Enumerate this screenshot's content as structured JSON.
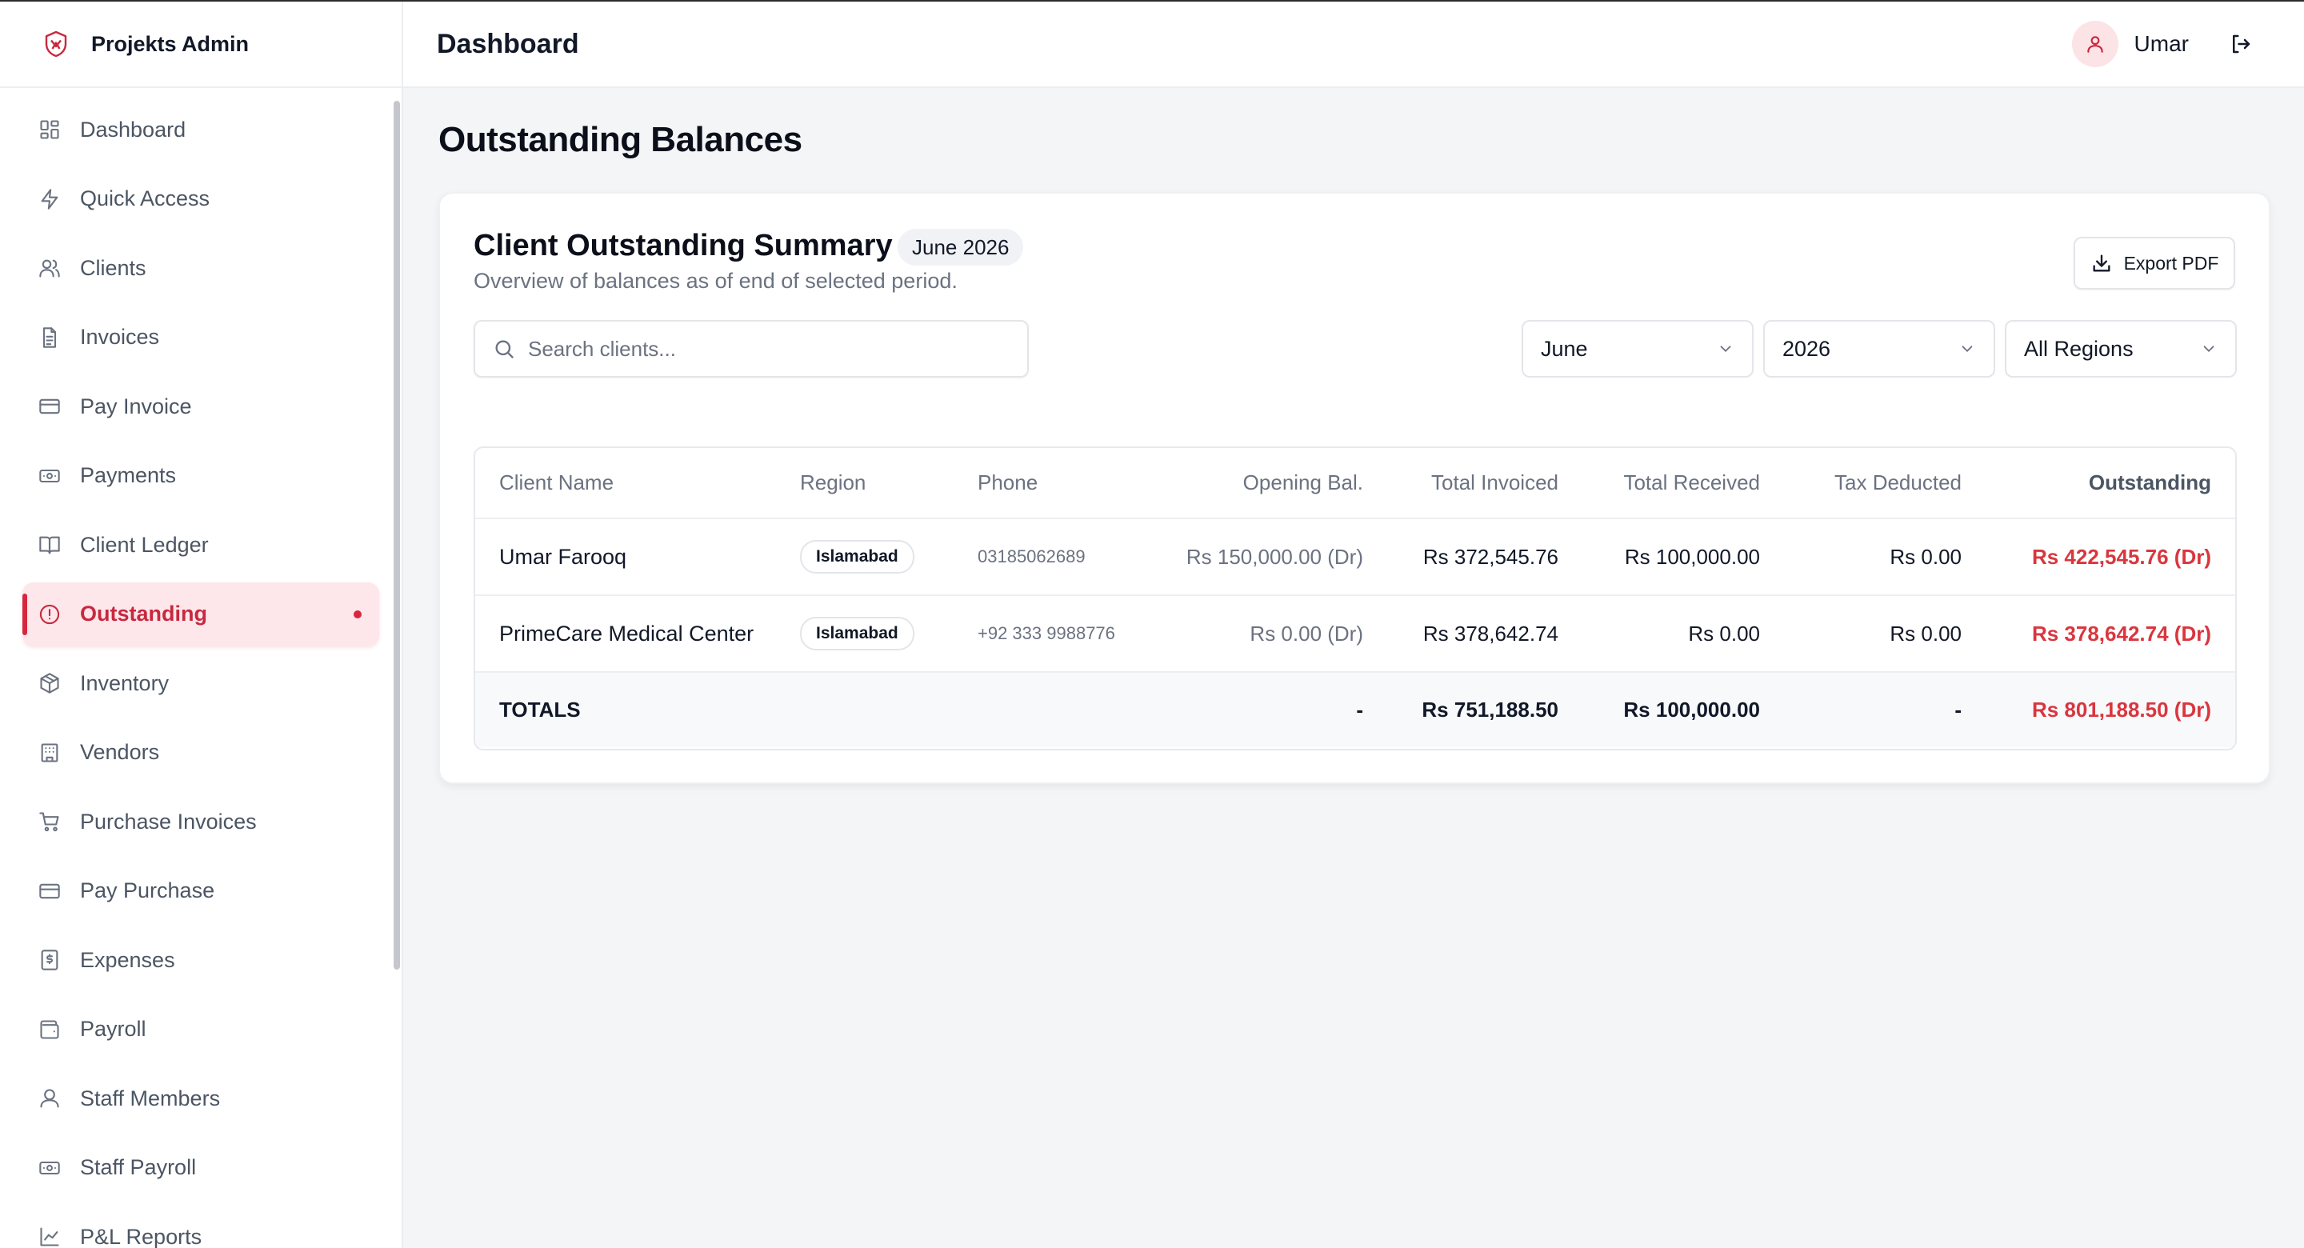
{
  "brand": {
    "name": "Projekts Admin"
  },
  "sidebar": {
    "items": [
      {
        "label": "Dashboard",
        "icon": "dashboard-icon"
      },
      {
        "label": "Quick Access",
        "icon": "lightning-icon"
      },
      {
        "label": "Clients",
        "icon": "users-icon"
      },
      {
        "label": "Invoices",
        "icon": "document-icon"
      },
      {
        "label": "Pay Invoice",
        "icon": "credit-card-icon"
      },
      {
        "label": "Payments",
        "icon": "cash-icon"
      },
      {
        "label": "Client Ledger",
        "icon": "book-icon"
      },
      {
        "label": "Outstanding",
        "icon": "alert-circle-icon",
        "active": true
      },
      {
        "label": "Inventory",
        "icon": "package-icon"
      },
      {
        "label": "Vendors",
        "icon": "building-icon"
      },
      {
        "label": "Purchase Invoices",
        "icon": "cart-icon"
      },
      {
        "label": "Pay Purchase",
        "icon": "credit-card-icon"
      },
      {
        "label": "Expenses",
        "icon": "receipt-icon"
      },
      {
        "label": "Payroll",
        "icon": "wallet-icon"
      },
      {
        "label": "Staff Members",
        "icon": "user-icon"
      },
      {
        "label": "Staff Payroll",
        "icon": "cash-icon"
      },
      {
        "label": "P&L Reports",
        "icon": "chart-icon"
      }
    ]
  },
  "header": {
    "title": "Dashboard",
    "user_name": "Umar"
  },
  "page": {
    "title": "Outstanding Balances"
  },
  "card": {
    "title": "Client Outstanding Summary",
    "period_badge": "June 2026",
    "subtitle": "Overview of balances as of end of selected period.",
    "export_label": "Export PDF",
    "search_placeholder": "Search clients...",
    "filters": {
      "month": "June",
      "year": "2026",
      "region": "All Regions"
    }
  },
  "table": {
    "columns": [
      "Client Name",
      "Region",
      "Phone",
      "Opening Bal.",
      "Total Invoiced",
      "Total Received",
      "Tax Deducted",
      "Outstanding"
    ],
    "rows": [
      {
        "name": "Umar Farooq",
        "region": "Islamabad",
        "phone": "03185062689",
        "opening": "Rs 150,000.00 (Dr)",
        "invoiced": "Rs 372,545.76",
        "received": "Rs 100,000.00",
        "tax": "Rs 0.00",
        "outstanding": "Rs 422,545.76 (Dr)"
      },
      {
        "name": "PrimeCare Medical Center",
        "region": "Islamabad",
        "phone": "+92 333 9988776",
        "opening": "Rs 0.00 (Dr)",
        "invoiced": "Rs 378,642.74",
        "received": "Rs 0.00",
        "tax": "Rs 0.00",
        "outstanding": "Rs 378,642.74 (Dr)"
      }
    ],
    "totals": {
      "label": "TOTALS",
      "opening": "-",
      "invoiced": "Rs 751,188.50",
      "received": "Rs 100,000.00",
      "tax": "-",
      "outstanding": "Rs 801,188.50 (Dr)"
    }
  },
  "colors": {
    "accent": "#d7263d",
    "outstanding_text": "#d9363e",
    "active_bg": "#fde7ea"
  }
}
